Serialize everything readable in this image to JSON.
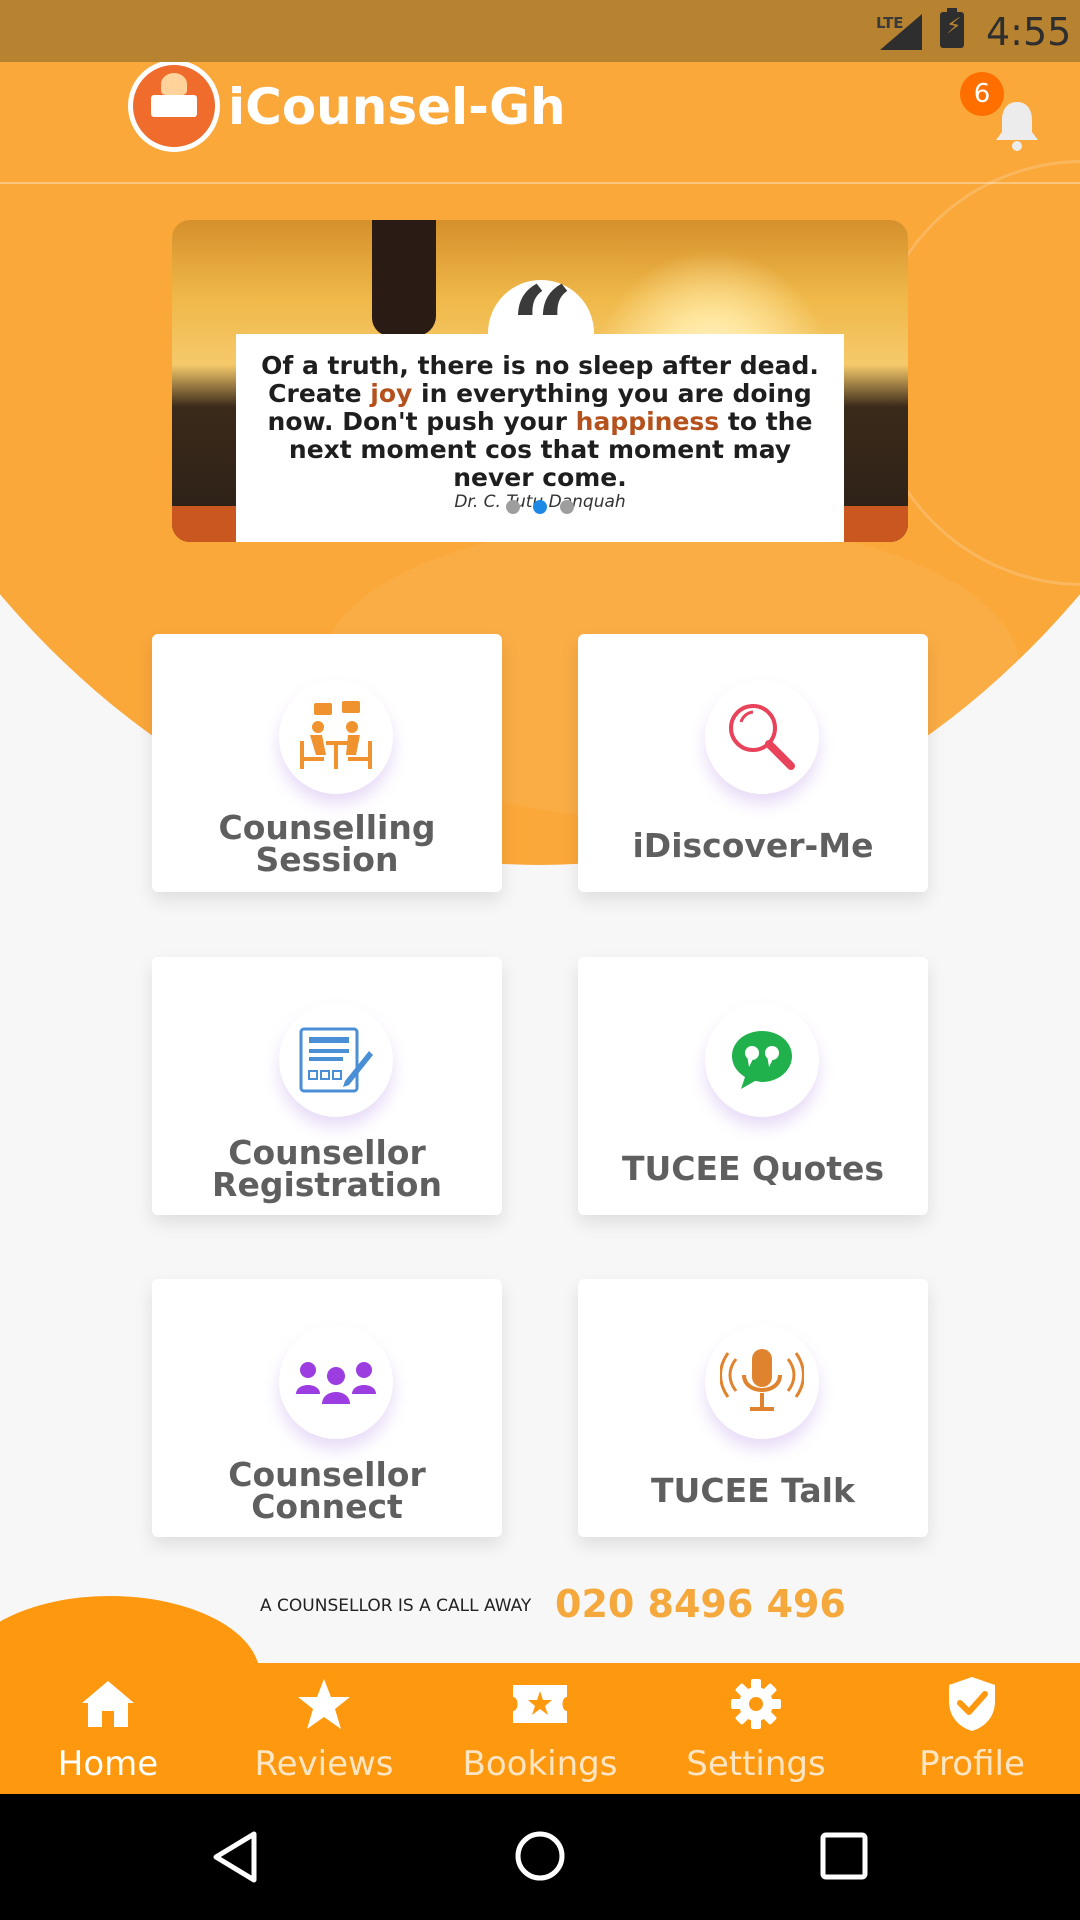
{
  "status_bar": {
    "network": "LTE",
    "time": "4:55"
  },
  "app_bar": {
    "title": "iCounsel-Gh",
    "notification_count": "6"
  },
  "carousel": {
    "quote_parts": [
      "Of a truth, there is no sleep after dead. Create ",
      "joy",
      " in everything you are doing now. Don't push your ",
      "happiness",
      " to the next moment cos that moment may never come."
    ],
    "author": "Dr. C. Tutu Danquah",
    "slide_count": 3,
    "active_slide": 2
  },
  "tiles": [
    {
      "label_line1": "Counselling",
      "label_line2": "Session",
      "icon": "counselling-session-icon",
      "color": "#f0922e"
    },
    {
      "label_line1": "iDiscover-Me",
      "label_line2": "",
      "icon": "magnifier-icon",
      "color": "#e8435a"
    },
    {
      "label_line1": "Counsellor",
      "label_line2": "Registration",
      "icon": "registration-form-icon",
      "color": "#4a8fd6"
    },
    {
      "label_line1": "TUCEE Quotes",
      "label_line2": "",
      "icon": "quote-bubble-icon",
      "color": "#21b14c"
    },
    {
      "label_line1": "Counsellor",
      "label_line2": "Connect",
      "icon": "group-people-icon",
      "color": "#9b3de0"
    },
    {
      "label_line1": "TUCEE Talk",
      "label_line2": "",
      "icon": "microphone-icon",
      "color": "#e0832f"
    }
  ],
  "call": {
    "text": "A COUNSELLOR IS A CALL AWAY",
    "number": "020 8496 496"
  },
  "bottom_nav": {
    "items": [
      {
        "label": "Home",
        "icon": "home-icon"
      },
      {
        "label": "Reviews",
        "icon": "star-icon"
      },
      {
        "label": "Bookings",
        "icon": "ticket-star-icon"
      },
      {
        "label": "Settings",
        "icon": "gear-icon"
      },
      {
        "label": "Profile",
        "icon": "shield-check-icon"
      }
    ],
    "active": "Home"
  },
  "colors": {
    "accent": "#fd980f",
    "header_orange": "#fba83a",
    "status_bar": "#b88331",
    "phone_number": "#f5a83c"
  }
}
